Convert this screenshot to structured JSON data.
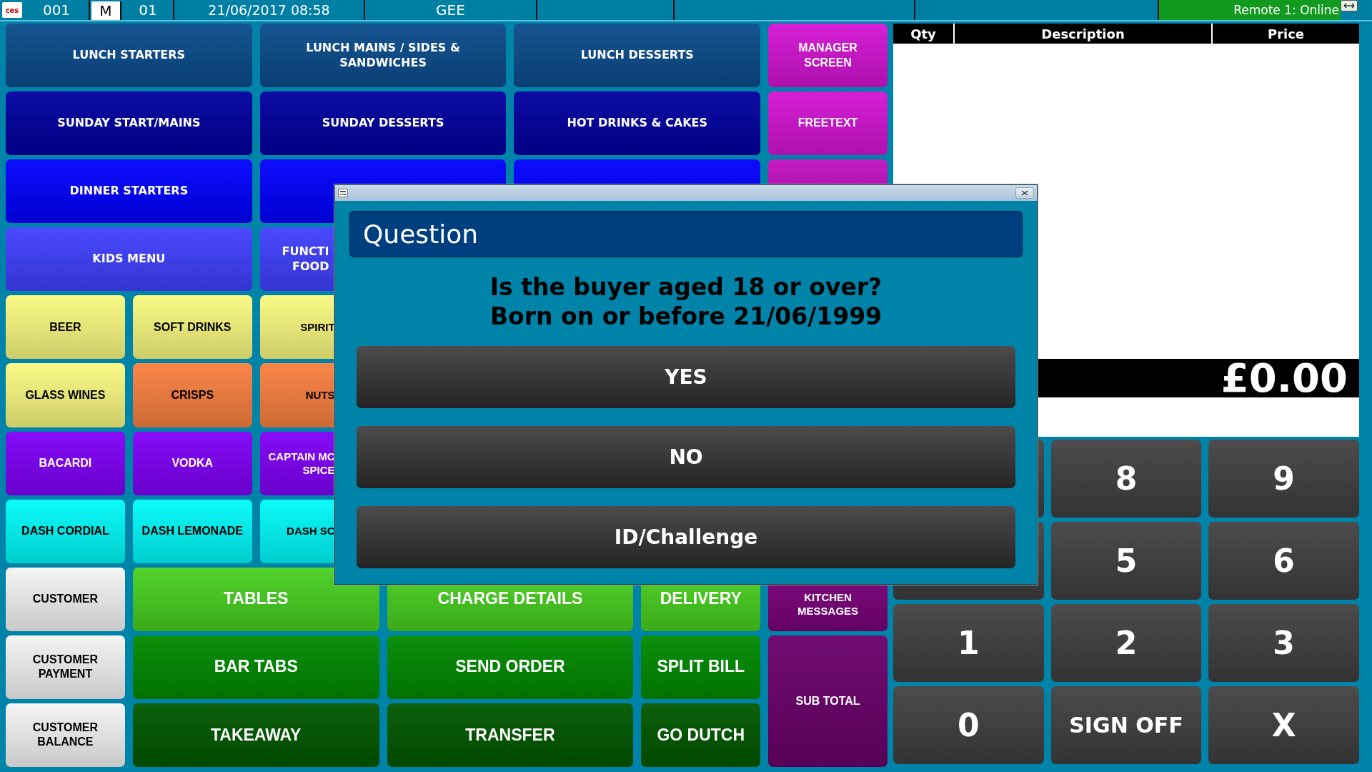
{
  "status_bar": {
    "logo": "ces",
    "fields": [
      {
        "text": "001",
        "kind": "plain"
      },
      {
        "text": "M",
        "kind": "boxed"
      },
      {
        "text": "01",
        "kind": "plain"
      },
      {
        "text": "21/06/2017 08:58",
        "kind": "plain"
      },
      {
        "text": "GEE",
        "kind": "plain"
      },
      {
        "kind": "empty"
      },
      {
        "kind": "empty"
      },
      {
        "kind": "empty"
      }
    ],
    "remote": "Remote 1: Online"
  },
  "menu_rows": [
    [
      {
        "label": "LUNCH STARTERS",
        "color": "#0a4c8c",
        "kind": "light",
        "wide": true
      },
      {
        "label": "LUNCH MAINS / SIDES & SANDWICHES",
        "color": "#0a4c8c",
        "kind": "light",
        "wide": true
      },
      {
        "label": "LUNCH DESSERTS",
        "color": "#0a4c8c",
        "kind": "light",
        "wide": true
      },
      {
        "label": "MANAGER SCREEN",
        "color": "#d414d4",
        "kind": "light",
        "wide": false
      }
    ],
    [
      {
        "label": "SUNDAY START/MAINS",
        "color": "#0000a0",
        "kind": "light",
        "wide": true
      },
      {
        "label": "SUNDAY DESSERTS",
        "color": "#0000a0",
        "kind": "light",
        "wide": true
      },
      {
        "label": "HOT DRINKS & CAKES",
        "color": "#0000a0",
        "kind": "light",
        "wide": true
      },
      {
        "label": "FREETEXT",
        "color": "#d414d4",
        "kind": "light",
        "wide": false
      }
    ],
    [
      {
        "label": "DINNER STARTERS",
        "color": "#0000ff",
        "kind": "light",
        "wide": true
      },
      {
        "color": "#0000ff",
        "kind": "light",
        "wide": true
      },
      {
        "color": "#0000ff",
        "kind": "light",
        "wide": true
      },
      {
        "color": "#c010c0",
        "kind": "light",
        "wide": false
      }
    ],
    [
      {
        "label": "KIDS MENU",
        "color": "#4040ff",
        "kind": "light",
        "wide": true
      },
      {
        "label": "FUNCTI FOOD",
        "color": "#4040ff",
        "kind": "light",
        "wide": true,
        "covered_right": true
      }
    ],
    [
      {
        "label": "BEER",
        "color": "#fafa80",
        "kind": "dark",
        "wide": false
      },
      {
        "label": "SOFT DRINKS",
        "color": "#fafa80",
        "kind": "dark",
        "wide": false
      },
      {
        "label": "SPIRIT",
        "color": "#fafa80",
        "kind": "dark",
        "wide": false,
        "covered_right": true
      }
    ],
    [
      {
        "label": "GLASS WINES",
        "color": "#fafa80",
        "kind": "dark",
        "wide": false
      },
      {
        "label": "CRISPS",
        "color": "#fa8040",
        "kind": "dark",
        "wide": false
      },
      {
        "label": "NUTS",
        "color": "#fa8040",
        "kind": "dark",
        "wide": false,
        "covered_right": true
      }
    ],
    [
      {
        "label": "BACARDI",
        "color": "#8000f8",
        "kind": "light",
        "wide": false
      },
      {
        "label": "VODKA",
        "color": "#8000f8",
        "kind": "light",
        "wide": false
      },
      {
        "label": "CAPTAIN MC SPICE",
        "color": "#8000f8",
        "kind": "light",
        "wide": false,
        "covered_right": true
      }
    ],
    [
      {
        "label": "DASH CORDIAL",
        "color": "#00fafa",
        "kind": "dark",
        "wide": false
      },
      {
        "label": "DASH LEMONADE",
        "color": "#00fafa",
        "kind": "dark",
        "wide": false
      },
      {
        "label": "DASH SC",
        "color": "#00fafa",
        "kind": "dark",
        "wide": false,
        "covered_right": true
      }
    ],
    [
      {
        "label": "CUSTOMER",
        "color": "#f4f4f4",
        "kind": "dark",
        "wide": false
      },
      {
        "label": "TABLES",
        "color": "#48d020",
        "kind": "light",
        "wide": true,
        "big": true
      },
      {
        "label": "CHARGE DETAILS",
        "color": "#48d020",
        "kind": "light",
        "wide": true,
        "big": true
      },
      {
        "label": "DELIVERY",
        "color": "#48d020",
        "kind": "light",
        "wide": false,
        "big": true
      },
      {
        "label": "KITCHEN MESSAGES",
        "color": "#7a007a",
        "kind": "light",
        "wide": false,
        "covered_top": true
      }
    ],
    [
      {
        "label": "CUSTOMER PAYMENT",
        "color": "#f4f4f4",
        "kind": "dark",
        "wide": false
      },
      {
        "label": "BAR TABS",
        "color": "#008a00",
        "kind": "light",
        "wide": true,
        "big": true
      },
      {
        "label": "SEND ORDER",
        "color": "#008a00",
        "kind": "light",
        "wide": true,
        "big": true
      },
      {
        "label": "SPLIT BILL",
        "color": "#008a00",
        "kind": "light",
        "wide": false,
        "big": true
      },
      {
        "label": "SUB TOTAL",
        "color": "#6a006a",
        "kind": "light",
        "wide": false,
        "tall": true
      }
    ],
    [
      {
        "label": "CUSTOMER BALANCE",
        "color": "#f4f4f4",
        "kind": "dark",
        "wide": false
      },
      {
        "label": "TAKEAWAY",
        "color": "#005800",
        "kind": "light",
        "wide": true,
        "big": true
      },
      {
        "label": "TRANSFER",
        "color": "#005800",
        "kind": "light",
        "wide": true,
        "big": true
      },
      {
        "label": "GO DUTCH",
        "color": "#005800",
        "kind": "light",
        "wide": false,
        "big": true
      }
    ]
  ],
  "order": {
    "columns": [
      "Qty",
      "Description",
      "Price"
    ],
    "total": "£0.00"
  },
  "keypad": {
    "rows": [
      [
        "8",
        "9"
      ],
      [
        "5",
        "6"
      ],
      [
        "1",
        "2",
        "3"
      ],
      [
        "0",
        "SIGN OFF",
        "X"
      ]
    ]
  },
  "dialog": {
    "header": "Question",
    "message": "Is the buyer aged 18 or over?\nBorn on or before 21/06/1999",
    "buttons": [
      "YES",
      "NO",
      "ID/Challenge"
    ]
  }
}
